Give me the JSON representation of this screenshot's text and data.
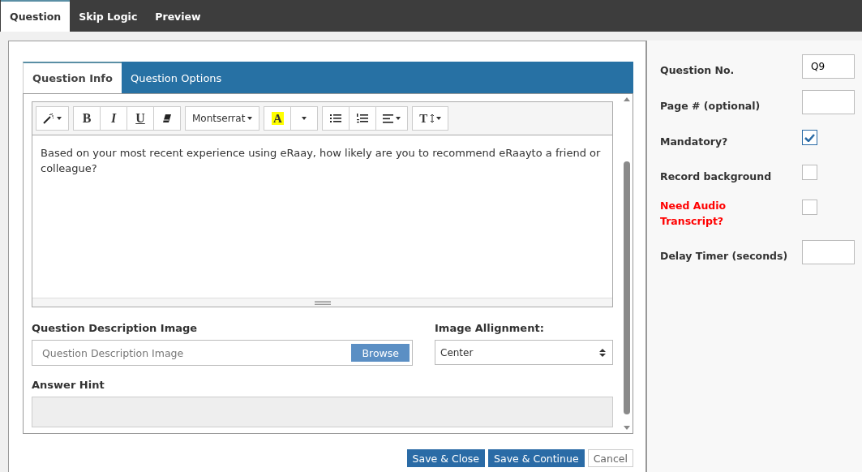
{
  "top_tabs": [
    {
      "label": "Question",
      "selected": true
    },
    {
      "label": "Skip Logic",
      "selected": false
    },
    {
      "label": "Preview",
      "selected": false
    }
  ],
  "inner_tabs": [
    {
      "label": "Question Info",
      "selected": true
    },
    {
      "label": "Question Options",
      "selected": false
    }
  ],
  "toolbar": [
    [
      {
        "kind": "wand"
      }
    ],
    [
      {
        "kind": "bold",
        "label": "B"
      },
      {
        "kind": "italic",
        "label": "I"
      },
      {
        "kind": "underline",
        "label": "U"
      },
      {
        "kind": "eraser"
      }
    ],
    [
      {
        "kind": "font",
        "label": "Montserrat"
      }
    ],
    [
      {
        "kind": "color",
        "label": "A"
      },
      {
        "kind": "caret"
      }
    ],
    [
      {
        "kind": "ul"
      },
      {
        "kind": "ol"
      },
      {
        "kind": "align"
      }
    ],
    [
      {
        "kind": "size",
        "label": "T"
      }
    ]
  ],
  "question_text": "Based on your most recent experience using eRaay, how likely are you to recommend eRaayto a friend or colleague?",
  "image_field": {
    "label": "Question Description Image",
    "placeholder": "Question Description Image",
    "button": "Browse"
  },
  "alignment": {
    "label": "Image Allignment:",
    "value": "Center"
  },
  "answer_hint": {
    "label": "Answer Hint",
    "disabled": true
  },
  "buttons": [
    {
      "label": "Save & Close",
      "kind": "primary"
    },
    {
      "label": "Save & Continue",
      "kind": "primary"
    },
    {
      "label": "Cancel",
      "kind": "plain"
    }
  ],
  "settings": [
    {
      "label": "Question No.",
      "kind": "text",
      "value": "Q9",
      "alert": false
    },
    {
      "label": "Page # (optional)",
      "kind": "text",
      "alert": false
    },
    {
      "label": "Mandatory?",
      "kind": "checkbox",
      "checked": true,
      "alert": false
    },
    {
      "label": "Record background",
      "kind": "checkbox",
      "checked": false,
      "alert": false
    },
    {
      "label": "Need Audio Transcript?",
      "kind": "checkbox",
      "checked": false,
      "alert": true
    },
    {
      "label": "Delay Timer (seconds)",
      "kind": "text",
      "alert": false
    }
  ]
}
